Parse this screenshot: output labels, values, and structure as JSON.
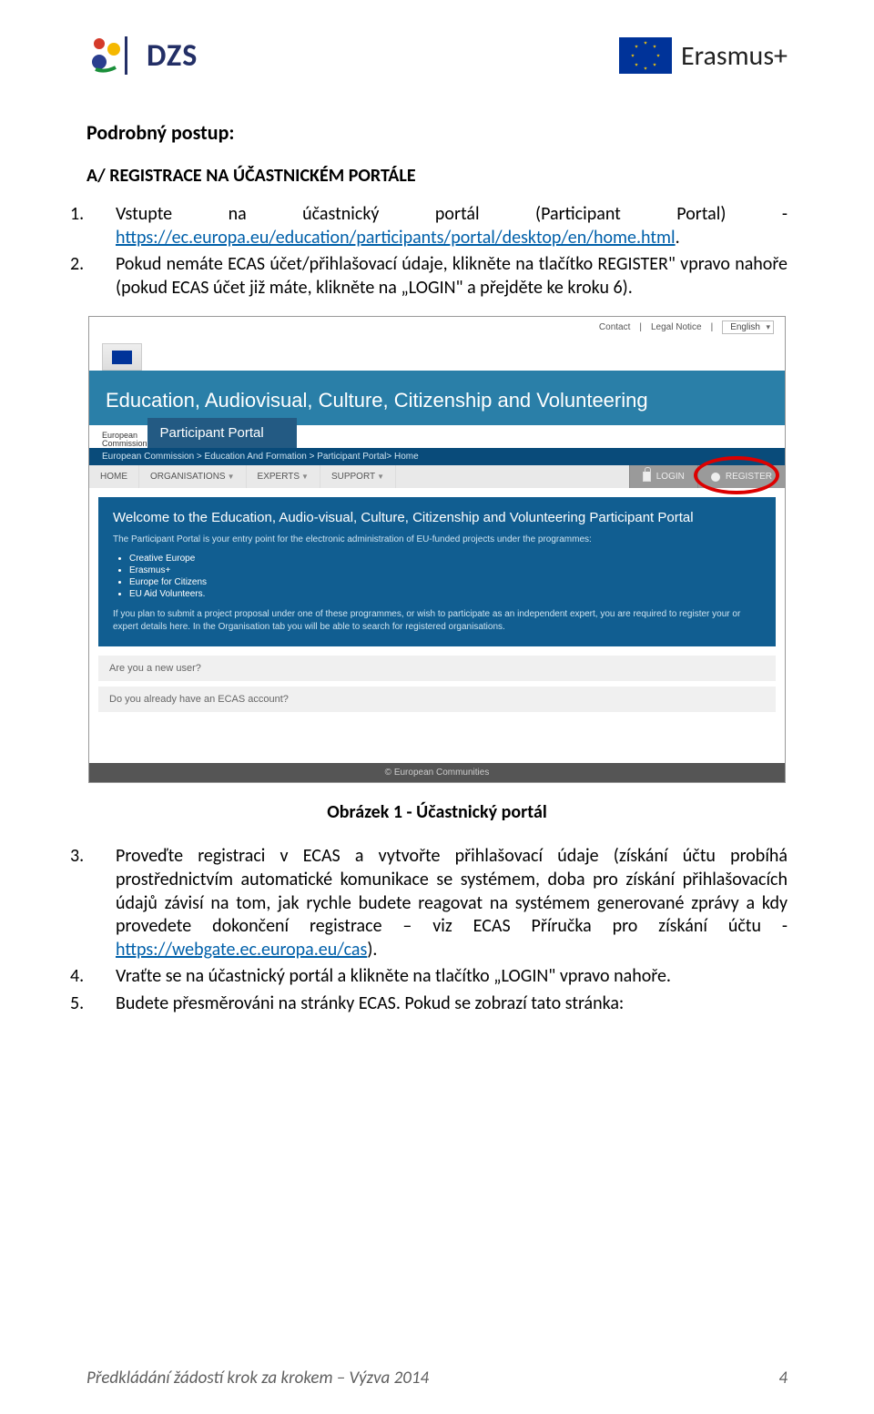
{
  "header": {
    "dzs_text": "DZS",
    "erasmus_text": "Erasmus+"
  },
  "title": "Podrobný postup:",
  "section_a": "A/ REGISTRACE NA ÚČASTNICKÉM PORTÁLE",
  "steps_top": [
    {
      "n": "1.",
      "text_before": "Vstupte na účastnický portál (Participant Portal) - ",
      "link": "https://ec.europa.eu/education/participants/portal/desktop/en/home.html",
      "text_after": "."
    },
    {
      "n": "2.",
      "text_before": "Pokud nemáte ECAS účet/přihlašovací údaje, klikněte na tlačítko REGISTER\" vpravo nahoře (pokud ECAS účet již máte, klikněte na „LOGIN\" a přejděte ke kroku 6).",
      "link": "",
      "text_after": ""
    }
  ],
  "figure": {
    "caption": "Obrázek 1 - Účastnický portál",
    "topbar": {
      "contact": "Contact",
      "legal": "Legal Notice",
      "lang": "English"
    },
    "ec_label": "European\nCommission",
    "title": "Education, Audiovisual, Culture, Citizenship and Volunteering",
    "subtitle": "Participant Portal",
    "breadcrumb": "European Commission >  Education And Formation >  Participant Portal>  Home",
    "menu_left": [
      "HOME",
      "ORGANISATIONS",
      "EXPERTS",
      "SUPPORT"
    ],
    "menu_right": {
      "login": "LOGIN",
      "register": "REGISTER"
    },
    "hero_title": "Welcome to the Education, Audio-visual, Culture, Citizenship and Volunteering Participant Portal",
    "hero_sub": "The Participant Portal is your entry point for the electronic administration of EU-funded projects under the programmes:",
    "hero_list": [
      "Creative Europe",
      "Erasmus+",
      "Europe for Citizens",
      "EU Aid Volunteers."
    ],
    "hero_foot": "If you plan to submit a project proposal under one of these programmes, or wish to participate as an independent expert, you are required to register your or expert details here. In the Organisation tab you will be able to search for registered organisations.",
    "row1": "Are you a new user?",
    "row2": "Do you already have an ECAS account?",
    "footer": "© European Communities"
  },
  "steps_bottom": [
    {
      "n": "3.",
      "text_a": "Proveďte registraci v ECAS a vytvořte přihlašovací údaje (získání účtu probíhá prostřednictvím automatické komunikace se systémem, doba pro získání přihlašovacích údajů závisí na tom, jak rychle budete reagovat na systémem generované zprávy a kdy provedete dokončení registrace – viz ECAS Příručka pro získání účtu -",
      "link": "https://webgate.ec.europa.eu/cas",
      "text_b": ")."
    },
    {
      "n": "4.",
      "text_a": "Vraťte se na účastnický portál a klikněte na tlačítko „LOGIN\" vpravo nahoře.",
      "link": "",
      "text_b": ""
    },
    {
      "n": "5.",
      "text_a": "Budete přesměrováni na stránky ECAS. Pokud se zobrazí tato stránka:",
      "link": "",
      "text_b": ""
    }
  ],
  "footer": {
    "left": "Předkládání žádostí krok za krokem – Výzva 2014",
    "right": "4"
  }
}
